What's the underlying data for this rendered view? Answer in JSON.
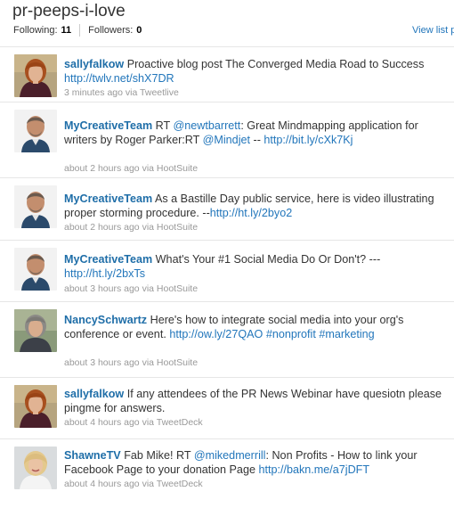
{
  "list_title": "pr-peeps-i-love",
  "stats": {
    "following_label": "Following:",
    "following_count": "11",
    "followers_label": "Followers:",
    "followers_count": "0"
  },
  "view_link": "View list p",
  "tweets": [
    {
      "user": "sallyfalkow",
      "text": "Proactive blog post The Converged Media Road to Success ",
      "link": "http://twlv.net/shX7DR",
      "time": "3 minutes ago",
      "via": "via Tweetlive",
      "avatar": "sally"
    },
    {
      "user": "MyCreativeTeam",
      "text1": "RT ",
      "mention1": "@newtbarrett",
      "text2": ": Great Mindmapping application for writers by Roger Parker:RT ",
      "mention2": "@Mindjet",
      "text3": " --",
      "link": "http://bit.ly/cXk7Kj",
      "time": "about 2 hours ago",
      "via": "via HootSuite",
      "avatar": "man"
    },
    {
      "user": "MyCreativeTeam",
      "text": "As a Bastille Day public service, here is video illustrating proper storming procedure. --",
      "link": "http://ht.ly/2byo2",
      "time": "about 2 hours ago",
      "via": "via HootSuite",
      "avatar": "man"
    },
    {
      "user": "MyCreativeTeam",
      "text": "What's Your #1 Social Media Do Or Don't? --- ",
      "link": "http://ht.ly/2bxTs",
      "time": "about 3 hours ago",
      "via": "via HootSuite",
      "avatar": "man"
    },
    {
      "user": "NancySchwartz",
      "text": "Here's how to integrate social media into your org's conference or event. ",
      "link": "http://ow.ly/27QAO",
      "hashtag1": "#nonprofit",
      "hashtag2": "#marketing",
      "time": "about 3 hours ago",
      "via": "via HootSuite",
      "avatar": "nancy"
    },
    {
      "user": "sallyfalkow",
      "text": "If any attendees of the PR News Webinar have quesiotn please pingme for answers.",
      "time": "about 4 hours ago",
      "via": "via TweetDeck",
      "avatar": "sally"
    },
    {
      "user": "ShawneTV",
      "text1": "Fab Mike! RT ",
      "mention1": "@mikedmerrill",
      "text2": ": Non Profits - How to link your Facebook Page to your donation Page ",
      "link": "http://bakn.me/a7jDFT",
      "time": "about 4 hours ago",
      "via": "via TweetDeck",
      "avatar": "shawne"
    }
  ]
}
